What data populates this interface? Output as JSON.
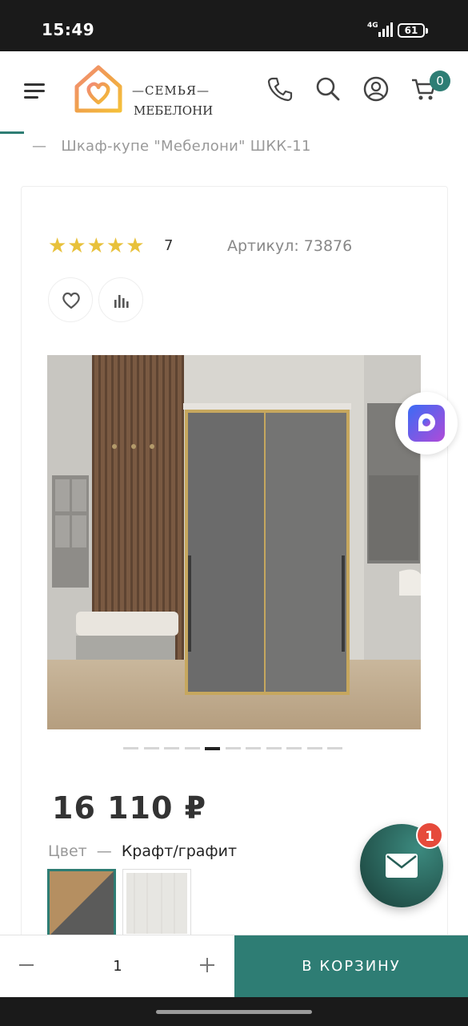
{
  "status": {
    "time": "15:49",
    "network": "4G",
    "battery": "61"
  },
  "header": {
    "logo_line1": "—СЕМЬЯ—",
    "logo_line2": "МЕБЕЛОНИ",
    "cart_count": "0",
    "icons": [
      "menu-icon",
      "phone-icon",
      "search-icon",
      "user-icon",
      "cart-icon"
    ],
    "accent_color": "#2e7d74"
  },
  "breadcrumb": {
    "separator": "—",
    "current": "Шкаф-купе \"Мебелони\" ШКК-11"
  },
  "product": {
    "stars": "★★★★★",
    "rating_count": "7",
    "article": "Артикул: 73876",
    "price": "16 110 ₽",
    "color_label": "Цвет",
    "color_separator": "—",
    "color_value": "Крафт/графит",
    "gallery": {
      "count": 11,
      "active_index": 4
    }
  },
  "chat": {
    "badge": "1"
  },
  "cart_bar": {
    "quantity": "1",
    "minus": "−",
    "plus": "+",
    "add_to_cart": "В КОРЗИНУ"
  }
}
